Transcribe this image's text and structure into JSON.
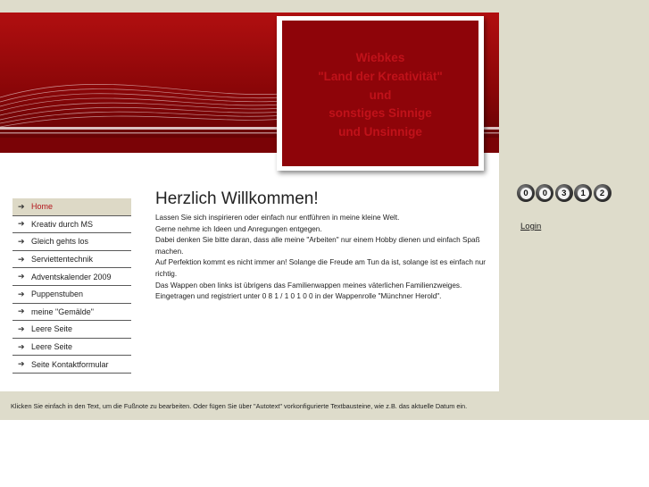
{
  "header": {
    "title_lines": [
      "Wiebkes",
      "\"Land der Kreativität\"",
      "und",
      "sonstiges Sinnige",
      "und Unsinnige"
    ]
  },
  "nav": {
    "items": [
      {
        "label": "Home",
        "active": true
      },
      {
        "label": "Kreativ durch MS"
      },
      {
        "label": "Gleich gehts los"
      },
      {
        "label": "Serviettentechnik"
      },
      {
        "label": "Adventskalender 2009"
      },
      {
        "label": "Puppenstuben"
      },
      {
        "label": "meine \"Gemälde\""
      },
      {
        "label": "Leere Seite"
      },
      {
        "label": "Leere Seite"
      },
      {
        "label": "Seite Kontaktformular"
      }
    ]
  },
  "main": {
    "heading": "Herzlich Willkommen!",
    "paragraphs": [
      "Lassen Sie sich inspirieren oder einfach nur entführen in meine kleine Welt.",
      "Gerne nehme ich Ideen und Anregungen entgegen.",
      "Dabei denken Sie bitte daran, dass alle meine \"Arbeiten\" nur einem Hobby dienen und einfach Spaß machen.",
      "Auf Perfektion kommt es nicht immer an! Solange die Freude am Tun da ist, solange ist es einfach nur richtig.",
      "Das Wappen oben links ist übrigens das Familienwappen meines väterlichen Familienzweiges.",
      "Eingetragen und registriert unter 0 8 1 / 1 0 1 0 0 in der Wappenrolle \"Münchner Herold\"."
    ]
  },
  "footer": {
    "text": "Klicken Sie einfach in den Text, um die Fußnote zu bearbeiten. Oder fügen Sie über \"Autotext\" vorkonfigurierte Textbausteine, wie z.B. das aktuelle Datum ein."
  },
  "sidebar": {
    "counter_digits": [
      "0",
      "0",
      "3",
      "1",
      "2"
    ],
    "login_label": "Login"
  },
  "colors": {
    "header_red": "#8e0409",
    "title_text": "#c0121a",
    "active_nav_text": "#b3151b",
    "page_background": "#dedccb"
  }
}
